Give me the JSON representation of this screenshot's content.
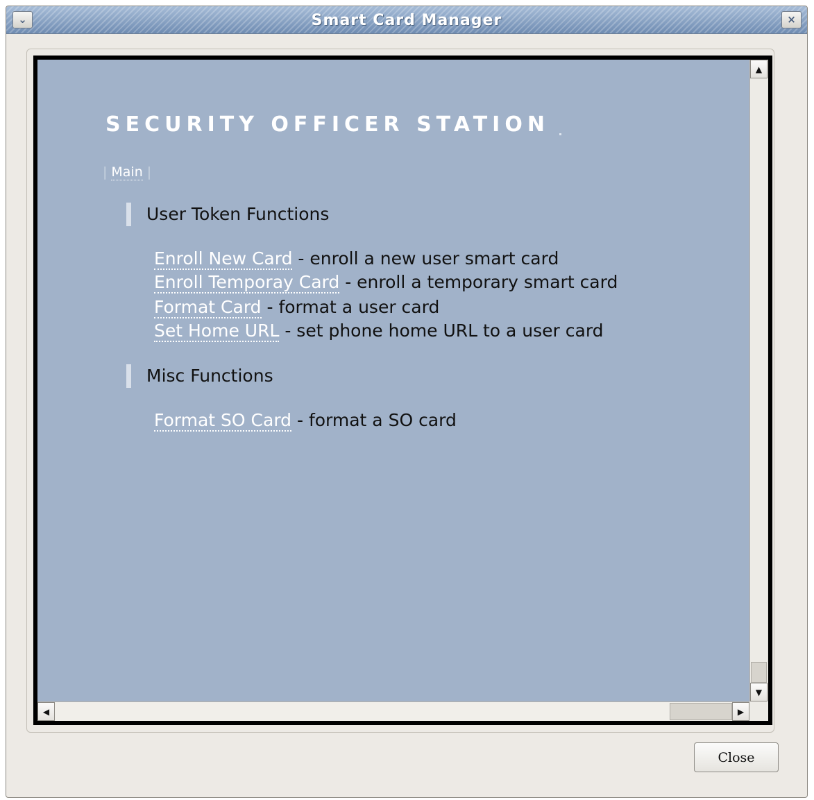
{
  "window": {
    "title": "Smart Card Manager",
    "menu_icon": "chevron-down-icon",
    "close_icon": "close-icon",
    "close_glyph": "×",
    "menu_glyph": "⌄"
  },
  "page": {
    "heading": "SECURITY OFFICER STATION",
    "breadcrumb": {
      "pipe": "|",
      "link": "Main"
    },
    "sections": [
      {
        "title": "User Token Functions",
        "items": [
          {
            "link": "Enroll New Card",
            "description": " - enroll a new user smart card"
          },
          {
            "link": "Enroll Temporay Card",
            "description": " - enroll a temporary smart card"
          },
          {
            "link": "Format Card",
            "description": " - format a user card"
          },
          {
            "link": "Set Home URL",
            "description": " - set phone home URL to a user card"
          }
        ]
      },
      {
        "title": "Misc Functions",
        "items": [
          {
            "link": "Format SO Card",
            "description": " - format a SO card"
          }
        ]
      }
    ]
  },
  "scrollbars": {
    "up_glyph": "▲",
    "down_glyph": "▼",
    "left_glyph": "◀",
    "right_glyph": "▶"
  },
  "footer": {
    "close_label": "Close"
  },
  "colors": {
    "content_background": "#a1b2c9",
    "title_gradient_top": "#a6bcd7",
    "title_gradient_bottom": "#6f8cb2",
    "link": "#ffffff",
    "window_background": "#edeae5"
  }
}
